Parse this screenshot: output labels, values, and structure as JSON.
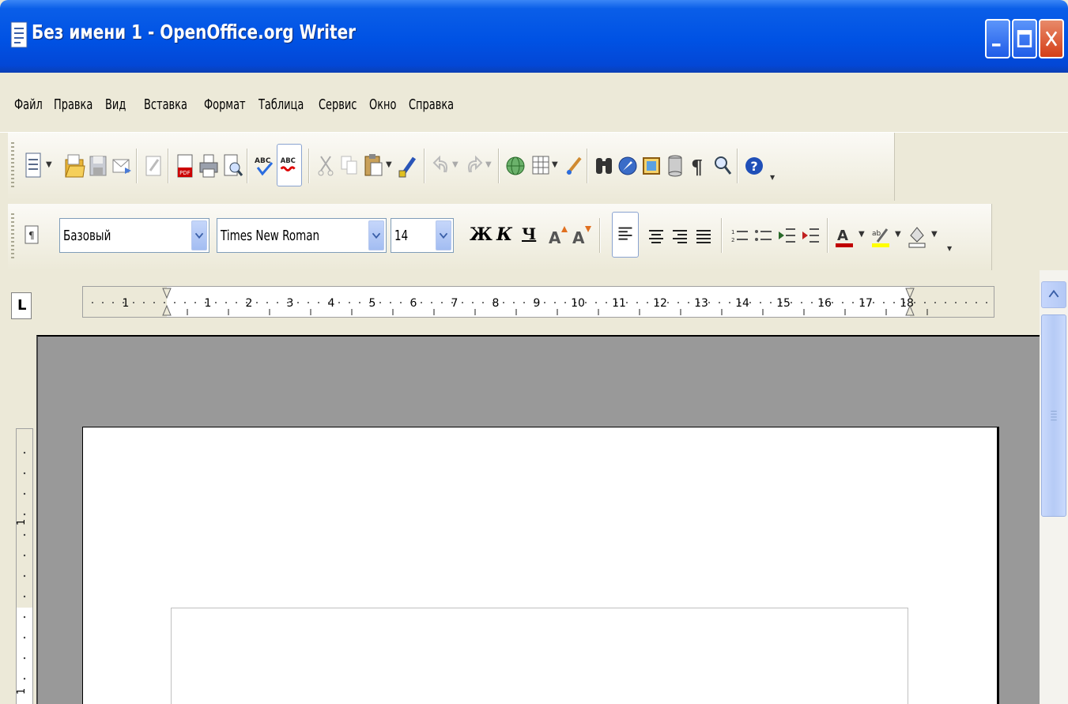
{
  "window": {
    "title": "Без имени 1 - OpenOffice.org Writer"
  },
  "menu": {
    "items": [
      "Файл",
      "Правка",
      "Вид",
      "Вставка",
      "Формат",
      "Таблица",
      "Сервис",
      "Окно",
      "Справка"
    ]
  },
  "standard_toolbar": {
    "icons": [
      "new-document-icon",
      "open-icon",
      "save-icon",
      "email-icon",
      "edit-file-icon",
      "export-pdf-icon",
      "print-icon",
      "page-preview-icon",
      "spellcheck-icon",
      "autospellcheck-icon",
      "cut-icon",
      "copy-icon",
      "paste-icon",
      "format-paintbrush-icon",
      "undo-icon",
      "redo-icon",
      "hyperlink-icon",
      "table-icon",
      "draw-functions-icon",
      "find-replace-icon",
      "navigator-icon",
      "gallery-icon",
      "data-sources-icon",
      "formatting-marks-icon",
      "zoom-icon",
      "help-icon"
    ]
  },
  "formatting_toolbar": {
    "paragraph_style": "Базовый",
    "font_name": "Times New Roman",
    "font_size": "14",
    "bold_label": "Ж",
    "italic_label": "К",
    "underline_label": "Ч",
    "icons": [
      "styles-formatting-icon",
      "grow-font-icon",
      "shrink-font-icon",
      "align-left-icon",
      "align-center-icon",
      "align-right-icon",
      "justify-icon",
      "numbering-icon",
      "bullets-icon",
      "decrease-indent-icon",
      "increase-indent-icon",
      "font-color-icon",
      "highlighting-icon",
      "background-color-icon"
    ],
    "active_alignment": "left",
    "font_color": "#c00000",
    "highlight_color": "#ffff00"
  },
  "ruler": {
    "corner_label": "L",
    "horizontal_labels": [
      "1",
      "1",
      "2",
      "3",
      "4",
      "5",
      "6",
      "7",
      "8",
      "9",
      "10",
      "11",
      "12",
      "13",
      "14",
      "15",
      "16",
      "17",
      "18"
    ],
    "vertical_labels": [
      "1",
      "1"
    ]
  },
  "document": {
    "name": "Без имени 1"
  }
}
